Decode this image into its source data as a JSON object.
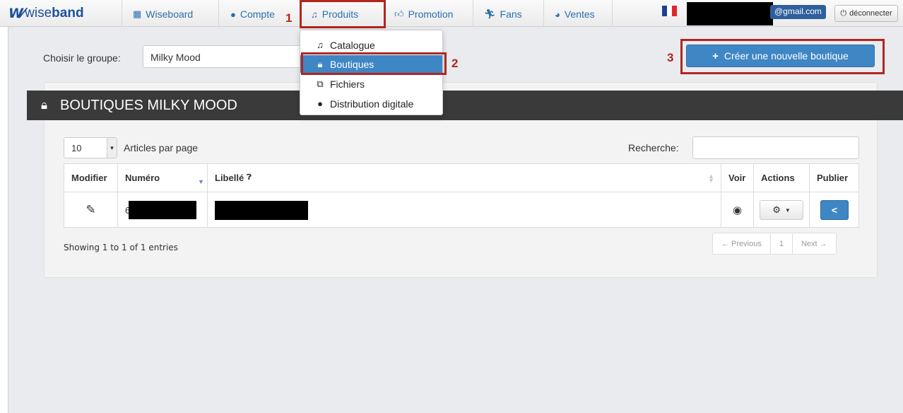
{
  "brand": {
    "mark": "W",
    "word1": "wise",
    "word2": "band"
  },
  "nav": {
    "items": [
      {
        "label": "Wiseboard",
        "icon": "grid-icon"
      },
      {
        "label": "Compte",
        "icon": "user-icon"
      },
      {
        "label": "Produits",
        "icon": "music-note-icon"
      },
      {
        "label": "Promotion",
        "icon": "thumbs-up-icon"
      },
      {
        "label": "Fans",
        "icon": "running-person-icon"
      },
      {
        "label": "Ventes",
        "icon": "dashboard-icon"
      }
    ],
    "email_suffix": "@gmail.com",
    "logout_label": "déconnecter"
  },
  "callouts": {
    "one": "1",
    "two": "2",
    "three": "3"
  },
  "dropdown": {
    "items": [
      {
        "label": "Catalogue",
        "icon": "music-note-icon"
      },
      {
        "label": "Boutiques",
        "icon": "lock-icon",
        "active": true
      },
      {
        "label": "Fichiers",
        "icon": "files-icon"
      },
      {
        "label": "Distribution digitale",
        "icon": "apple-icon"
      }
    ]
  },
  "group": {
    "label": "Choisir le groupe:",
    "value": "Milky Mood"
  },
  "create_button": "Créer une nouvelle boutique",
  "panel": {
    "title": "BOUTIQUES MILKY MOOD"
  },
  "table_controls": {
    "per_page_value": "10",
    "per_page_label": "Articles par page",
    "search_label": "Recherche:"
  },
  "table": {
    "headers": {
      "modifier": "Modifier",
      "numero": "Numéro",
      "libelle": "Libellé",
      "voir": "Voir",
      "actions": "Actions",
      "publier": "Publier"
    },
    "rows": [
      {
        "numero_prefix": "6"
      }
    ]
  },
  "footer": {
    "showing": "Showing 1 to 1 of 1 entries",
    "prev": "← Previous",
    "page": "1",
    "next": "Next →"
  },
  "colors": {
    "accent": "#3f86c4",
    "callout": "#b1261f",
    "title_bar": "#3a3a3a"
  }
}
